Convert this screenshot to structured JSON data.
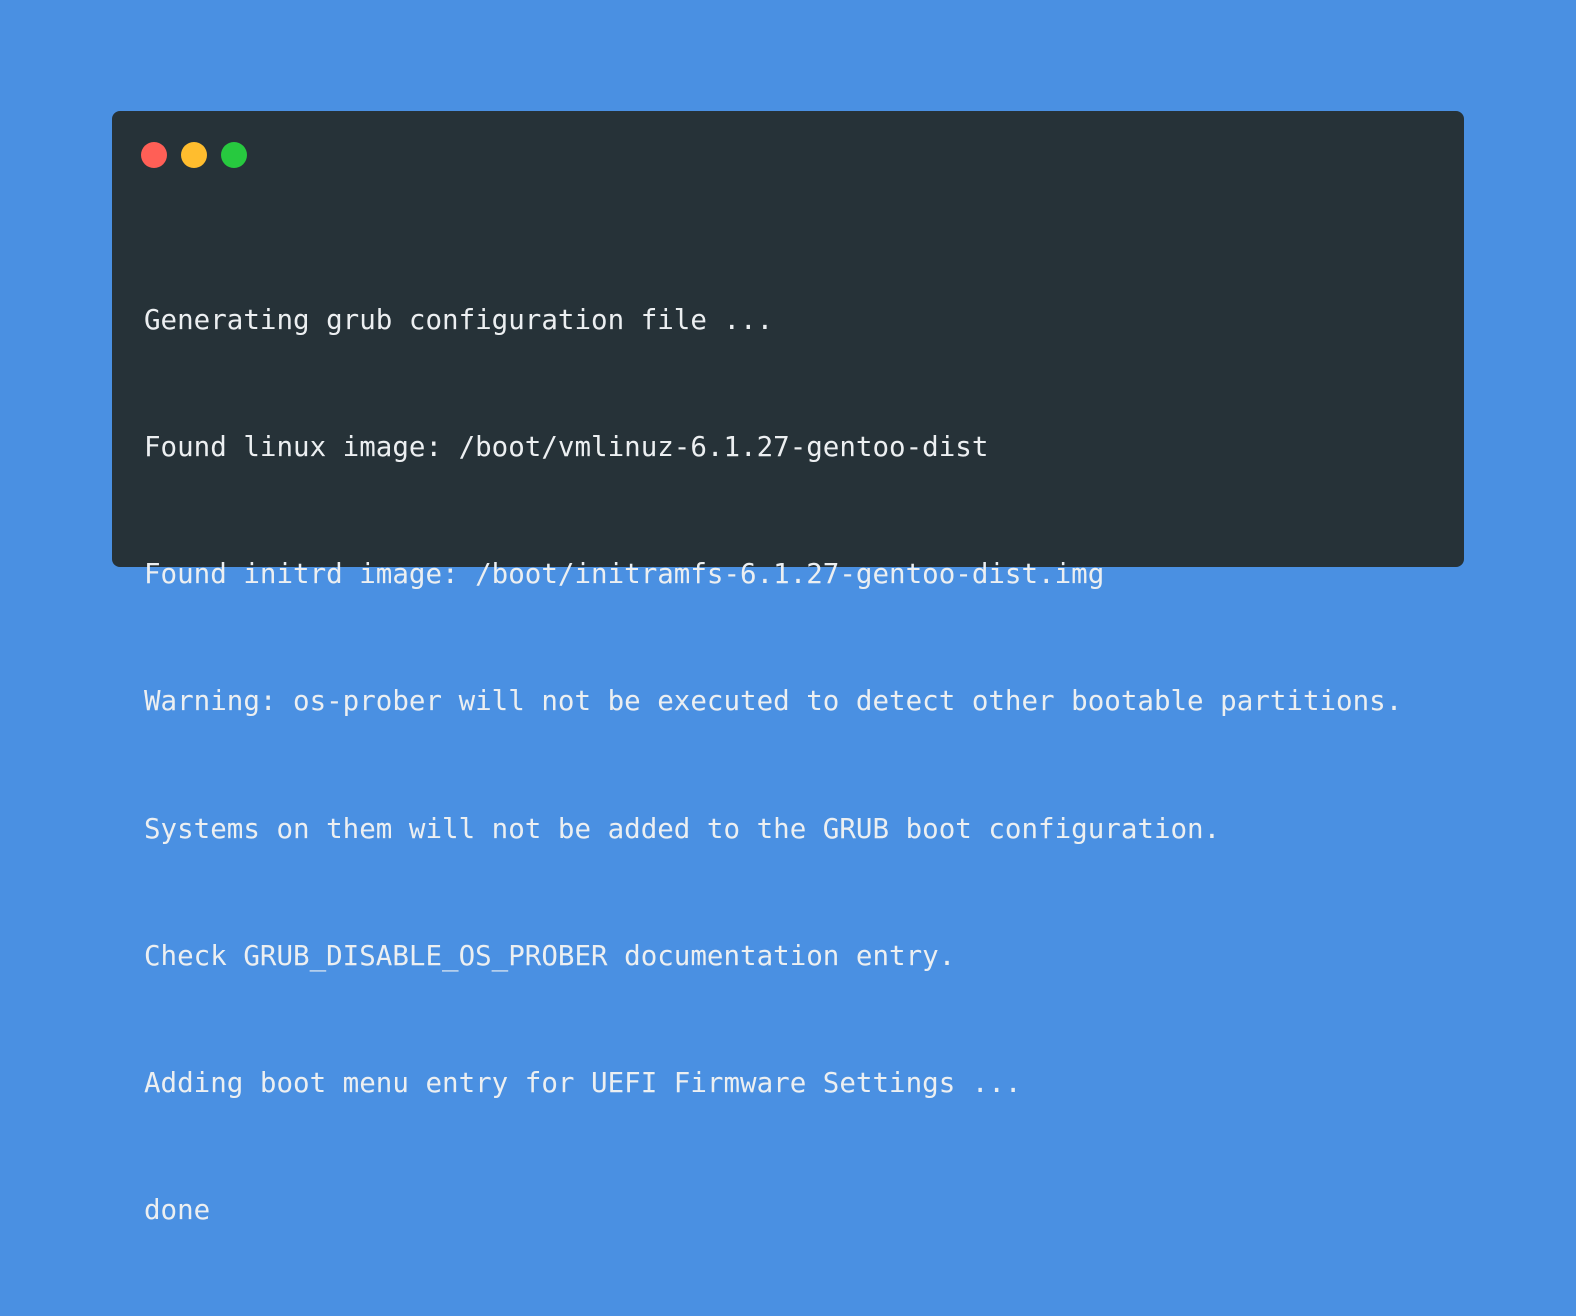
{
  "window": {
    "controls": [
      {
        "name": "close-button",
        "icon": "red-circle",
        "color": "#ff5f56"
      },
      {
        "name": "minimize-button",
        "icon": "yellow-circle",
        "color": "#ffbd2e"
      },
      {
        "name": "maximize-button",
        "icon": "green-circle",
        "color": "#27c93f"
      }
    ]
  },
  "terminal": {
    "lines": [
      "Generating grub configuration file ...",
      "Found linux image: /boot/vmlinuz-6.1.27-gentoo-dist",
      "Found initrd image: /boot/initramfs-6.1.27-gentoo-dist.img",
      "Warning: os-prober will not be executed to detect other bootable partitions.",
      "Systems on them will not be added to the GRUB boot configuration.",
      "Check GRUB_DISABLE_OS_PROBER documentation entry.",
      "Adding boot menu entry for UEFI Firmware Settings ...",
      "done"
    ]
  },
  "colors": {
    "background": "#4a90e2",
    "terminal_background": "#263238",
    "text": "#eceff1"
  }
}
